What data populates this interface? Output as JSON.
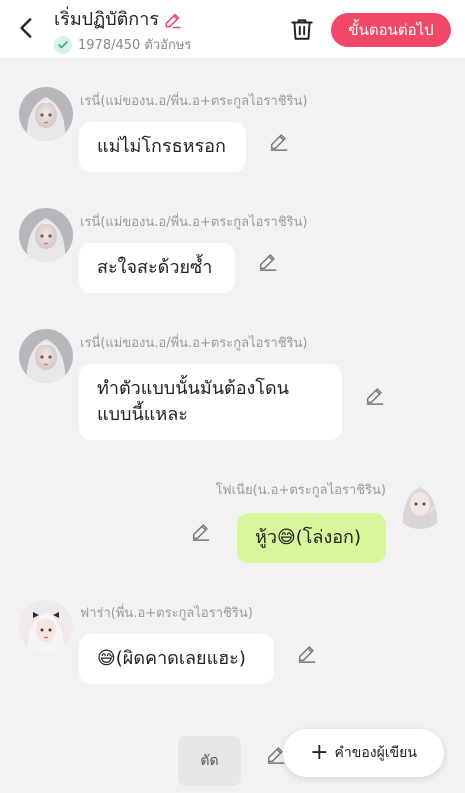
{
  "header": {
    "title": "เริ่มปฏิบัติการ",
    "count": "1978/450 ตัวอักษร",
    "next_label": "ขั้นตอนต่อไป"
  },
  "messages": [
    {
      "name": "เรนี่(แม่ของน.อ/พี่น.อ+ตระกูลไอราชิริน)",
      "text": "แม่ไม่โกรธหรอก"
    },
    {
      "name": "เรนี่(แม่ของน.อ/พี่น.อ+ตระกูลไอราชิริน)",
      "text": "สะใจสะด้วยซ้ำ"
    },
    {
      "name": "เรนี่(แม่ของน.อ/พี่น.อ+ตระกูลไอราชิริน)",
      "text_line1": "ทำตัวแบบนั้นมันต้องโดน",
      "text_line2": "แบบนี้แหละ"
    },
    {
      "name": "โฟเนีย(น.อ+ตระกูลไอราชิริน)",
      "text": "หู้ว😅(โล่งอก)"
    },
    {
      "name": "ฟาร่า(พี่น.อ+ตระกูลไอราชิริน)",
      "text": "😅(ผิดคาดเลยแฮะ)"
    }
  ],
  "footer": {
    "cut_label": "ตัด",
    "author_label": "คำของผู้เขียน"
  },
  "colors": {
    "accent": "#ef4869",
    "self_bubble": "#d7f59b",
    "background": "#f2f2f4"
  },
  "icons": [
    "back-icon",
    "pencil-icon",
    "check-icon",
    "trash-icon",
    "plus-icon"
  ]
}
